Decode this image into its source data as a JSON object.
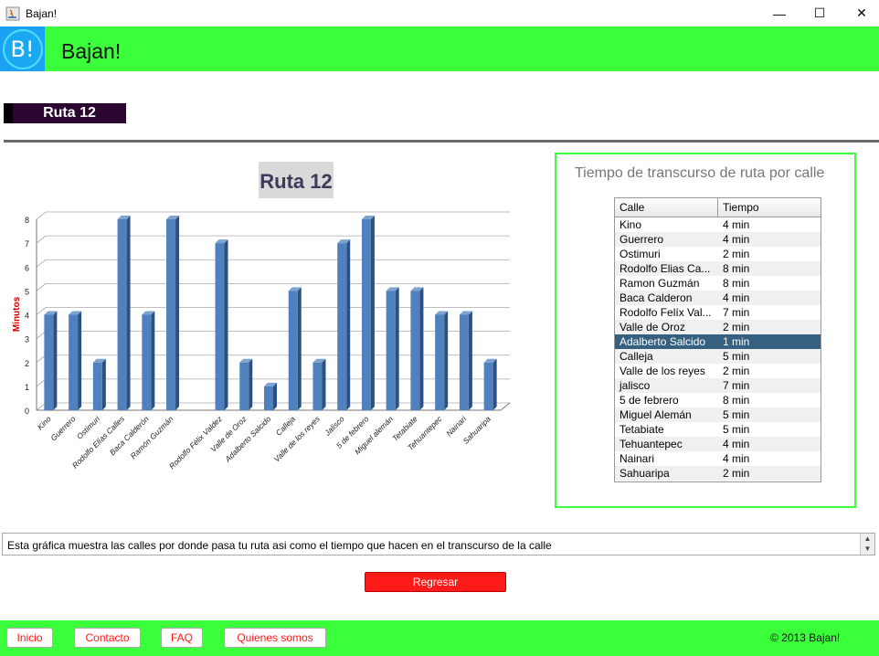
{
  "window": {
    "title": "Bajan!",
    "minimize": "—",
    "maximize": "☐",
    "close": "✕"
  },
  "header": {
    "logo_text": "B!",
    "brand": "Bajan!"
  },
  "route_label": "Ruta 12",
  "chart_data": {
    "type": "bar",
    "title": "Ruta 12",
    "ylabel": "Minutos",
    "xlabel": "",
    "ylim": [
      0,
      8
    ],
    "categories": [
      "Kino",
      "Guerrero",
      "Ostimuri",
      "Rodolfo Elías Calles",
      "Baca Calderón",
      "Ramón Guzmán",
      "Rodolfo Félix Valdez",
      "Valle de Oroz",
      "Adalberto Salcido",
      "Calleja",
      "Valle de los reyes",
      "Jalisco",
      "5 de febrero",
      "Miguel alemán",
      "Tetabiate",
      "Tehuantepec",
      "Nainari",
      "Sahuaripa"
    ],
    "values": [
      4,
      4,
      2,
      8,
      4,
      8,
      7,
      2,
      1,
      5,
      2,
      7,
      8,
      5,
      5,
      4,
      4,
      2
    ],
    "color": "#4f81bd",
    "grid": true
  },
  "panel": {
    "title": "Tiempo de transcurso de ruta por calle",
    "columns": [
      "Calle",
      "Tiempo"
    ],
    "rows": [
      [
        "Kino",
        "4 min"
      ],
      [
        "Guerrero",
        "4 min"
      ],
      [
        "Ostimuri",
        "2 min"
      ],
      [
        "Rodolfo Elias Ca...",
        "8 min"
      ],
      [
        "Ramon Guzmán",
        "8 min"
      ],
      [
        "Baca Calderon",
        "4 min"
      ],
      [
        "Rodolfo Felíx Val...",
        "7 min"
      ],
      [
        "Valle de Oroz",
        "2 min"
      ],
      [
        "Adalberto Salcido",
        "1 min"
      ],
      [
        "Calleja",
        "5 min"
      ],
      [
        "Valle de los reyes",
        "2 min"
      ],
      [
        "jalisco",
        "7 min"
      ],
      [
        "5 de febrero",
        "8 min"
      ],
      [
        "Miguel Alemán",
        "5 min"
      ],
      [
        "Tetabiate",
        "5 min"
      ],
      [
        "Tehuantepec",
        "4 min"
      ],
      [
        "Nainari",
        "4 min"
      ],
      [
        "Sahuaripa",
        "2 min"
      ]
    ],
    "selected_row": 8
  },
  "description": "Esta gráfica muestra las calles por donde pasa tu ruta asi como el tiempo que hacen en el transcurso de la calle",
  "back_button": "Regresar",
  "footer": {
    "links": [
      "Inicio",
      "Contacto",
      "FAQ",
      "Quienes somos"
    ],
    "copyright": "© 2013 Bajan!"
  }
}
